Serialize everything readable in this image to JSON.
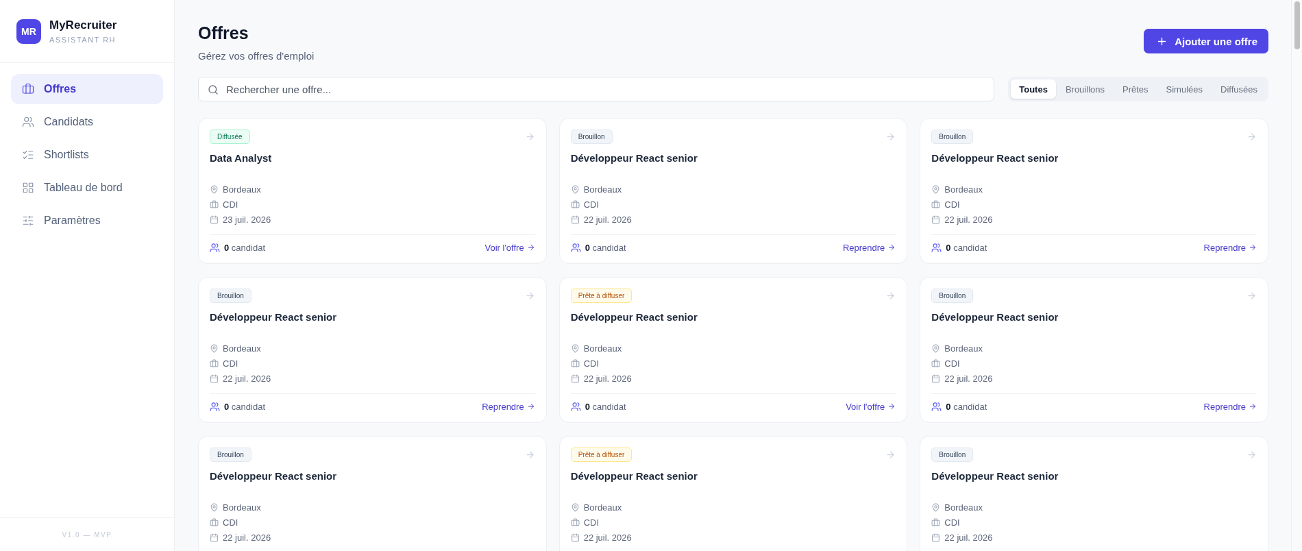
{
  "sidebar": {
    "logo": "MR",
    "app_name": "MyRecruiter",
    "tagline": "ASSISTANT RH",
    "items": [
      {
        "label": "Offres",
        "kind": "offers",
        "selected": true
      },
      {
        "label": "Candidats",
        "kind": "candidates",
        "selected": false
      },
      {
        "label": "Shortlists",
        "kind": "shortlists",
        "selected": false
      },
      {
        "label": "Tableau de bord",
        "kind": "dashboard",
        "selected": false
      },
      {
        "label": "Paramètres",
        "kind": "settings",
        "selected": false
      }
    ],
    "version": "V1.0 — MVP"
  },
  "header": {
    "title": "Offres",
    "subtitle": "Gérez vos offres d'emploi",
    "add_button": "Ajouter une offre"
  },
  "search": {
    "placeholder": "Rechercher une offre..."
  },
  "filters": [
    {
      "label": "Toutes",
      "selected": true
    },
    {
      "label": "Brouillons",
      "selected": false
    },
    {
      "label": "Prêtes",
      "selected": false
    },
    {
      "label": "Simulées",
      "selected": false
    },
    {
      "label": "Diffusées",
      "selected": false
    }
  ],
  "offers": [
    {
      "status": "Diffusée",
      "kind": "published",
      "title": "Data Analyst",
      "location": "Bordeaux",
      "contract": "CDI",
      "date": "23 juil. 2026",
      "candidates": "**0** candidat",
      "action": "Voir l'offre"
    },
    {
      "status": "Brouillon",
      "kind": "draft",
      "title": "Développeur React senior",
      "location": "Bordeaux",
      "contract": "CDI",
      "date": "22 juil. 2026",
      "candidates": "**0** candidat",
      "action": "Reprendre"
    },
    {
      "status": "Brouillon",
      "kind": "draft",
      "title": "Développeur React senior",
      "location": "Bordeaux",
      "contract": "CDI",
      "date": "22 juil. 2026",
      "candidates": "**0** candidat",
      "action": "Reprendre"
    },
    {
      "status": "Brouillon",
      "kind": "draft",
      "title": "Développeur React senior",
      "location": "Bordeaux",
      "contract": "CDI",
      "date": "22 juil. 2026",
      "candidates": "**0** candidat",
      "action": "Reprendre"
    },
    {
      "status": "Prête à diffuser",
      "kind": "ready",
      "title": "Développeur React senior",
      "location": "Bordeaux",
      "contract": "CDI",
      "date": "22 juil. 2026",
      "candidates": "**0** candidat",
      "action": "Voir l'offre"
    },
    {
      "status": "Brouillon",
      "kind": "draft",
      "title": "Développeur React senior",
      "location": "Bordeaux",
      "contract": "CDI",
      "date": "22 juil. 2026",
      "candidates": "**0** candidat",
      "action": "Reprendre"
    },
    {
      "status": "Brouillon",
      "kind": "draft",
      "title": "Développeur React senior",
      "location": "Bordeaux",
      "contract": "CDI",
      "date": "22 juil. 2026"
    },
    {
      "status": "Prête à diffuser",
      "kind": "ready",
      "title": "Développeur React senior",
      "location": "Bordeaux",
      "contract": "CDI",
      "date": "22 juil. 2026"
    },
    {
      "status": "Brouillon",
      "kind": "draft",
      "title": "Développeur React senior",
      "location": "Bordeaux",
      "contract": "CDI",
      "date": "22 juil. 2026"
    }
  ]
}
